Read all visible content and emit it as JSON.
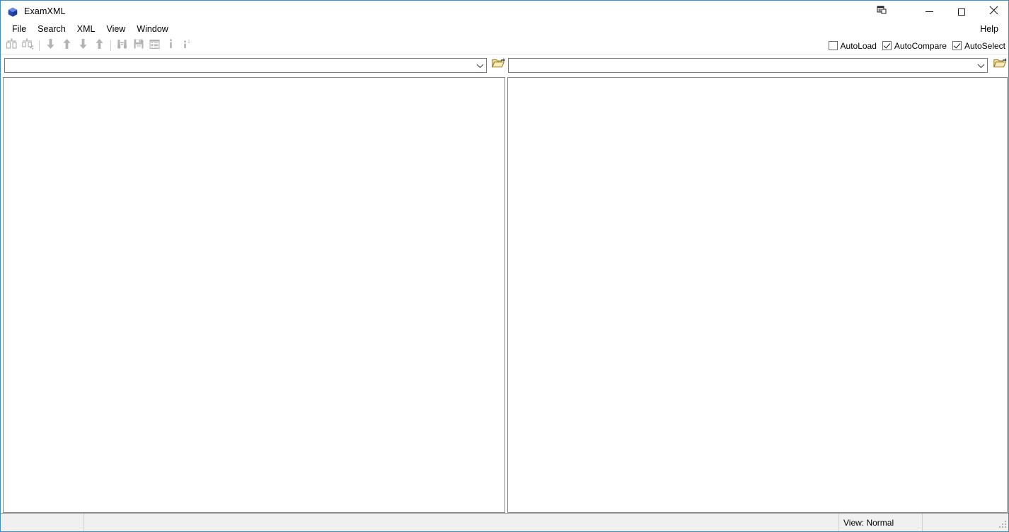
{
  "window": {
    "title": "ExamXML",
    "app_icon": "cube-icon",
    "controls": [
      {
        "name": "dock-window-button",
        "icon": "dock-window-icon",
        "label": ""
      },
      {
        "name": "minimize-button",
        "icon": "minimize-icon",
        "label": ""
      },
      {
        "name": "maximize-button",
        "icon": "maximize-icon",
        "label": ""
      },
      {
        "name": "close-button",
        "icon": "close-icon",
        "label": ""
      }
    ]
  },
  "menubar": {
    "items": [
      {
        "label": "File"
      },
      {
        "label": "Search"
      },
      {
        "label": "XML"
      },
      {
        "label": "View"
      },
      {
        "label": "Window"
      }
    ],
    "help_label": "Help"
  },
  "toolbar": {
    "buttons": [
      {
        "name": "compare-files-button",
        "icon": "compare-files-icon",
        "enabled": false
      },
      {
        "name": "compare-selected-button",
        "icon": "compare-selected-icon",
        "enabled": false
      },
      {
        "name": "next-difference-button",
        "icon": "arrow-down-icon",
        "enabled": false
      },
      {
        "name": "previous-difference-button",
        "icon": "arrow-up-icon",
        "enabled": false
      },
      {
        "name": "next-change-button",
        "icon": "arrow-down-icon",
        "enabled": false
      },
      {
        "name": "previous-change-button",
        "icon": "arrow-up-icon",
        "enabled": false
      },
      {
        "name": "find-button",
        "icon": "binoculars-icon",
        "enabled": false
      },
      {
        "name": "save-button",
        "icon": "floppy-disk-icon",
        "enabled": false
      },
      {
        "name": "report-button",
        "icon": "grid-list-icon",
        "enabled": false
      },
      {
        "name": "info-button",
        "icon": "info-icon",
        "enabled": false
      },
      {
        "name": "info-first-button",
        "icon": "info-superscript-one-icon",
        "enabled": false
      }
    ],
    "options": [
      {
        "name": "autoload-checkbox",
        "label": "AutoLoad",
        "checked": false
      },
      {
        "name": "autocompare-checkbox",
        "label": "AutoCompare",
        "checked": true
      },
      {
        "name": "autoselect-checkbox",
        "label": "AutoSelect",
        "checked": true
      }
    ]
  },
  "path_row": {
    "left": {
      "combo_value": "",
      "combo_placeholder": "",
      "dropdown_icon": "chevron-down-icon",
      "browse_icon": "open-folder-icon"
    },
    "right": {
      "combo_value": "",
      "combo_placeholder": "",
      "dropdown_icon": "chevron-down-icon",
      "browse_icon": "open-folder-icon"
    }
  },
  "panes": {
    "left": {
      "name": "left-xml-pane",
      "content": ""
    },
    "right": {
      "name": "right-xml-pane",
      "content": ""
    }
  },
  "statusbar": {
    "segment1": "",
    "segment2": "",
    "view_status": "View: Normal",
    "segment4": "",
    "grip_icon": "resize-grip-icon"
  },
  "colors": {
    "window_border": "#3f8ec1",
    "toolbar_icon_disabled": "#b3b3b3",
    "folder_icon": "#a08a2e",
    "folder_icon_fill": "#f2df9a",
    "statusbar_bg": "#f0f0f0",
    "pane_border": "#878787",
    "accent_blue": "#2a4fb0"
  }
}
